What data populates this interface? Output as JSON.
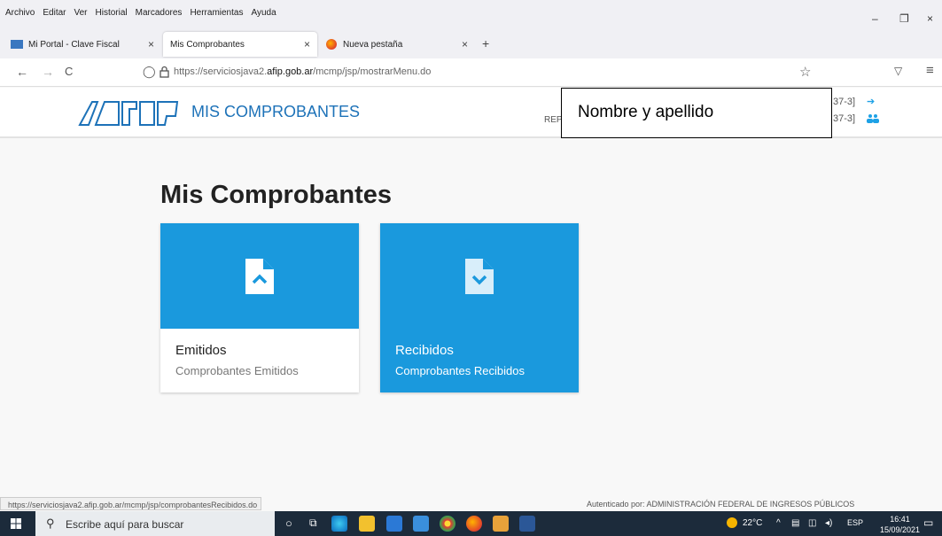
{
  "browser": {
    "menu": [
      "Archivo",
      "Editar",
      "Ver",
      "Historial",
      "Marcadores",
      "Herramientas",
      "Ayuda"
    ],
    "window_controls": {
      "minimize": "–",
      "maximize": "❐",
      "close": "×"
    },
    "tabs": [
      {
        "label": "Mi Portal - Clave Fiscal",
        "close": "×"
      },
      {
        "label": "Mis Comprobantes",
        "close": "×"
      },
      {
        "label": "Nueva pestaña",
        "close": "×"
      }
    ],
    "new_tab": "+",
    "nav": {
      "back": "←",
      "forward": "→",
      "reload": "C"
    },
    "url_prefix": "https://serviciosjava2.",
    "url_domain": "afip.gob.ar",
    "url_path": "/mcmp/jsp/mostrarMenu.do",
    "bookmark_star": "☆",
    "pocket_icon": "▽",
    "menu_icon": "≡"
  },
  "header": {
    "app_title": "MIS COMPROBANTES",
    "name_box": "Nombre y apellido",
    "rep_text": "REP",
    "cuit_line1": "37-3]",
    "cuit_line2": "37-3]"
  },
  "main": {
    "title": "Mis Comprobantes",
    "cards": [
      {
        "title": "Emitidos",
        "subtitle": "Comprobantes Emitidos"
      },
      {
        "title": "Recibidos",
        "subtitle": "Comprobantes Recibidos"
      }
    ]
  },
  "status": {
    "link": "https://serviciosjava2.afip.gob.ar/mcmp/jsp/comprobantesRecibidos.do",
    "auth": "Autenticado por: ADMINISTRACIÓN FEDERAL DE INGRESOS PÚBLICOS"
  },
  "taskbar": {
    "search_placeholder": "Escribe aquí para buscar",
    "temperature": "22°C",
    "language": "ESP",
    "time": "16:41",
    "date": "15/09/2021"
  },
  "colors": {
    "accent": "#1a99dd",
    "title_blue": "#1d72b8"
  }
}
